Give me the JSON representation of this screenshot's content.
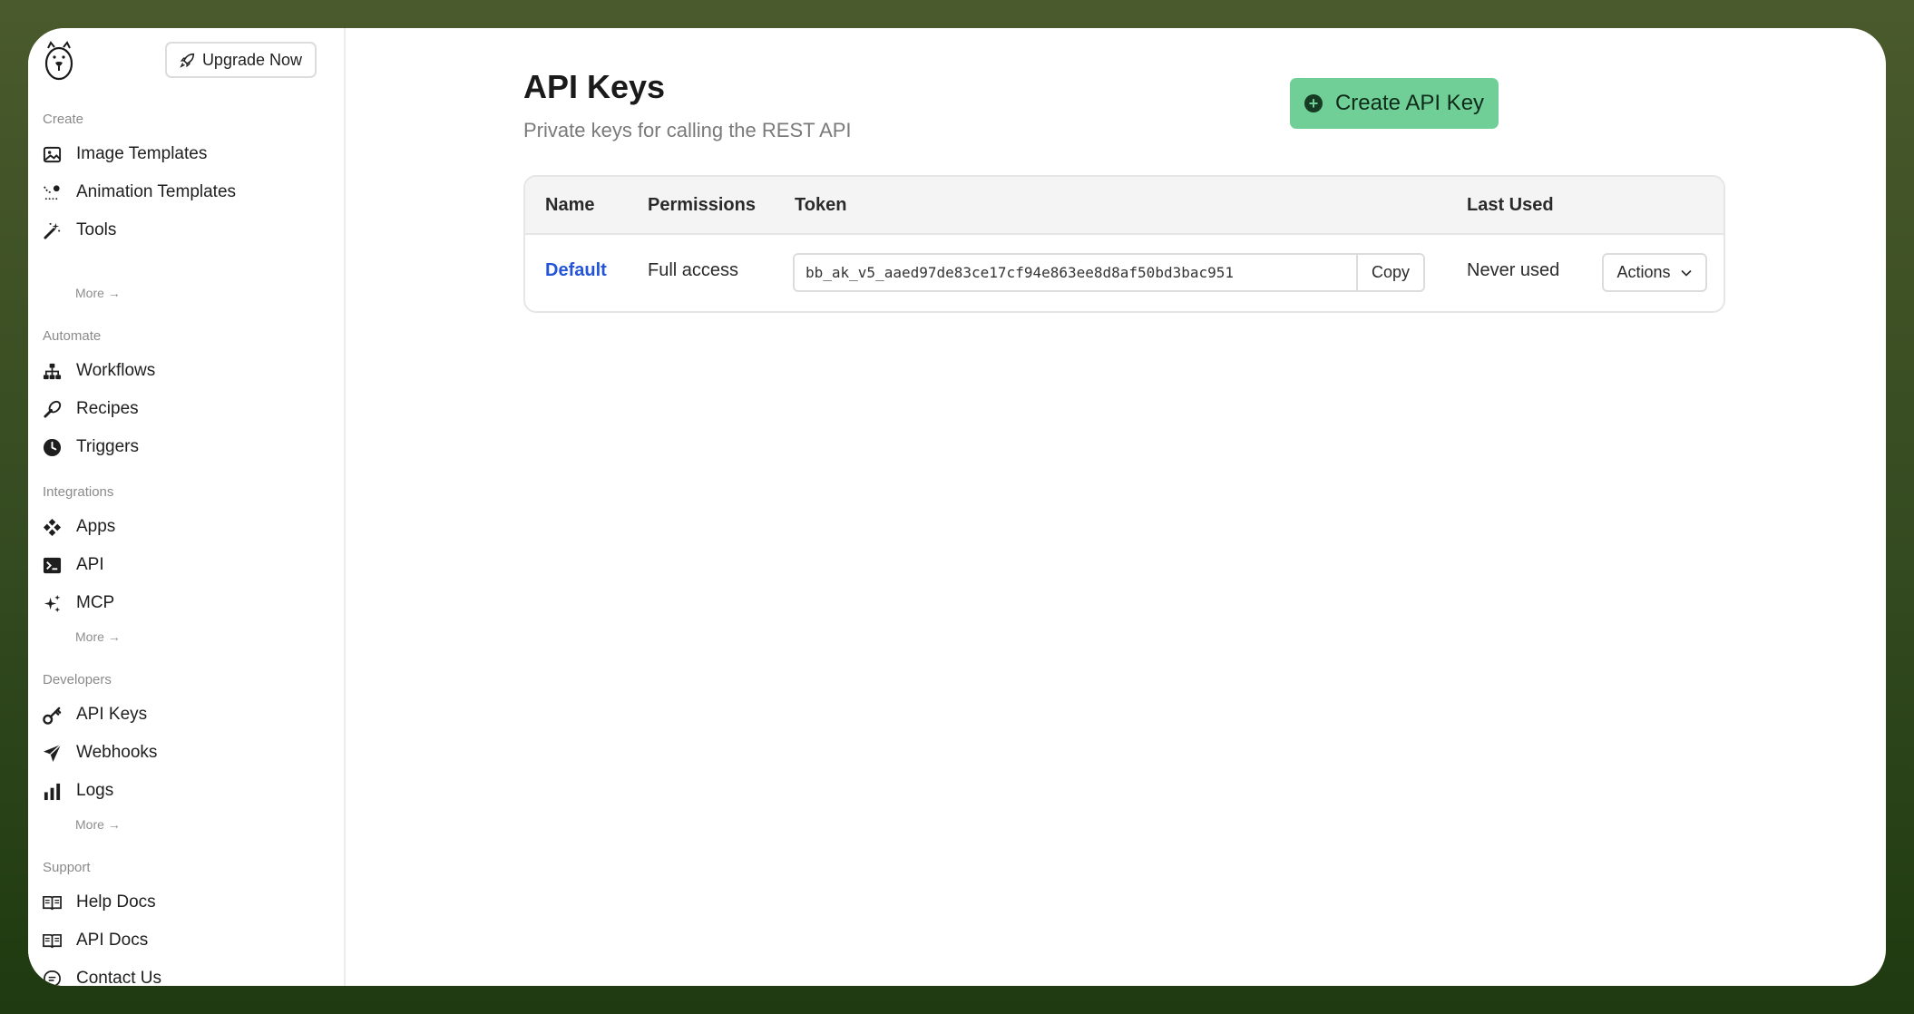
{
  "sidebar": {
    "upgrade_label": "Upgrade Now",
    "sections": {
      "create": "Create",
      "automate": "Automate",
      "integrations": "Integrations",
      "developers": "Developers",
      "support": "Support"
    },
    "items": {
      "image_templates": "Image Templates",
      "animation_templates": "Animation Templates",
      "tools": "Tools",
      "workflows": "Workflows",
      "recipes": "Recipes",
      "triggers": "Triggers",
      "apps": "Apps",
      "api": "API",
      "mcp": "MCP",
      "api_keys": "API Keys",
      "webhooks": "Webhooks",
      "logs": "Logs",
      "help_docs": "Help Docs",
      "api_docs": "API Docs",
      "contact_us": "Contact Us"
    },
    "more_label": "More →"
  },
  "main": {
    "title": "API Keys",
    "subtitle": "Private keys for calling the REST API",
    "create_label": "Create API Key",
    "table": {
      "headers": {
        "name": "Name",
        "permissions": "Permissions",
        "token": "Token",
        "last_used": "Last Used"
      },
      "row": {
        "name": "Default",
        "permissions": "Full access",
        "token": "bb_ak_v5_aaed97de83ce17cf94e863ee8d8af50bd3bac951",
        "copy_label": "Copy",
        "last_used": "Never used",
        "actions_label": "Actions"
      }
    }
  },
  "colors": {
    "accent_green": "#6fcf97",
    "link_blue": "#2454d8",
    "frame_green": "#344a20"
  }
}
